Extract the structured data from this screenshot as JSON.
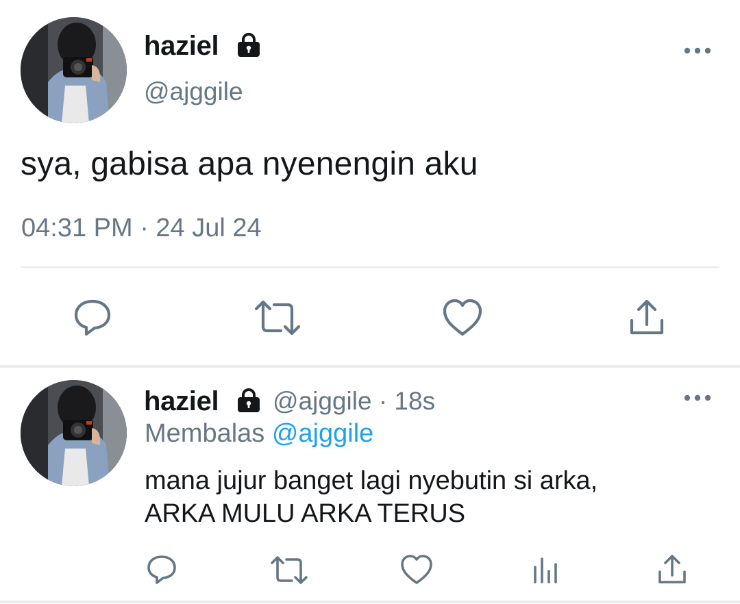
{
  "main_tweet": {
    "display_name": "haziel",
    "handle": "@ajggile",
    "text": "sya, gabisa apa nyenengin aku",
    "timestamp": "04:31 PM · 24 Jul 24",
    "actions": [
      "reply-icon",
      "retweet-icon",
      "like-icon",
      "share-icon"
    ]
  },
  "reply_tweet": {
    "display_name": "haziel",
    "handle": "@ajggile",
    "separator": "·",
    "time_ago": "18s",
    "replying_label": "Membalas",
    "replying_to": "@ajggile",
    "text_line1": "mana jujur banget lagi nyebutin si arka,",
    "text_line2": "ARKA MULU ARKA TERUS",
    "actions": [
      "reply-icon",
      "retweet-icon",
      "like-icon",
      "analytics-icon",
      "share-icon"
    ]
  },
  "colors": {
    "text": "#14171a",
    "secondary": "#657786",
    "accent": "#1da1f2",
    "divider": "#e6ecf0"
  }
}
